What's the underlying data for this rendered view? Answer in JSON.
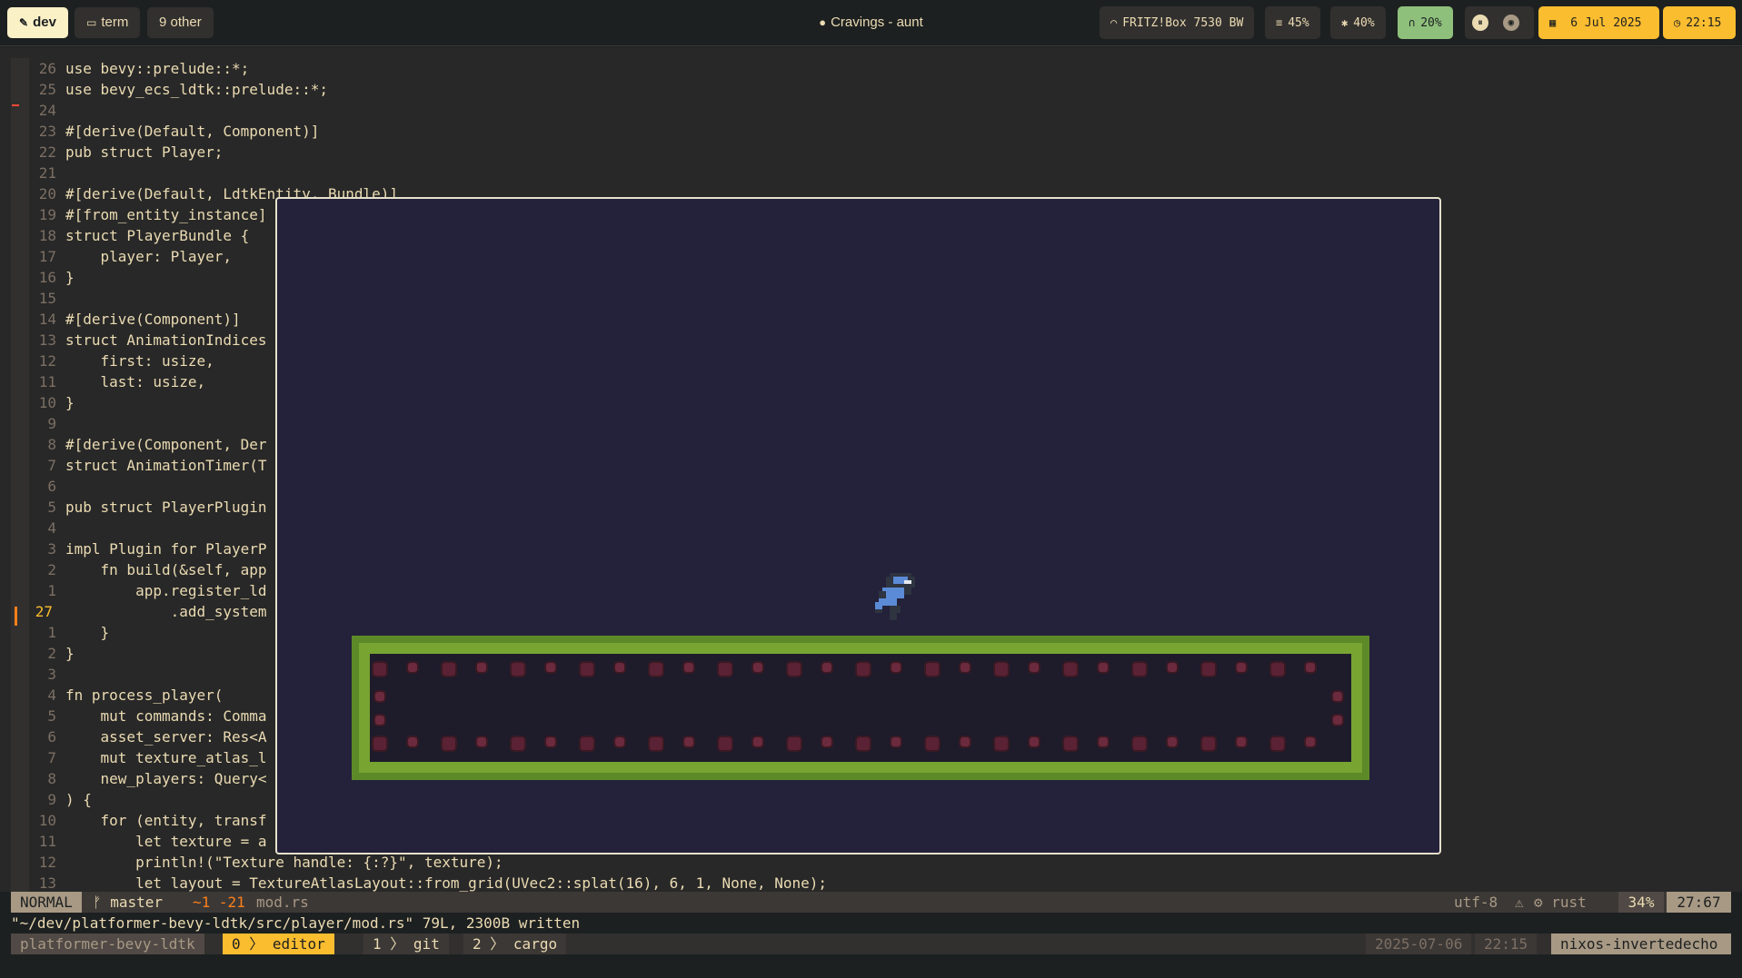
{
  "topbar": {
    "workspaces": [
      {
        "label": "dev",
        "icon": "code-icon"
      },
      {
        "label": "term",
        "icon": "terminal-icon"
      },
      {
        "label": "9 other",
        "icon": ""
      }
    ],
    "window_title": "Cravings - aunt",
    "wifi": "FRITZ!Box 7530 BW",
    "disk": "45%",
    "cpu": "40%",
    "headphones": "20%",
    "date": "6 Jul 2025",
    "time": "22:15",
    "colors": {
      "active": "#fbf1c7",
      "green": "#8ec07c",
      "yellow": "#fabd2f"
    }
  },
  "editor": {
    "lines": [
      {
        "n": "26",
        "text": "use bevy::prelude::*;"
      },
      {
        "n": "25",
        "text": "use bevy_ecs_ldtk::prelude::*;"
      },
      {
        "n": "24",
        "text": ""
      },
      {
        "n": "23",
        "text": "#[derive(Default, Component)]"
      },
      {
        "n": "22",
        "text": "pub struct Player;"
      },
      {
        "n": "21",
        "text": ""
      },
      {
        "n": "20",
        "text": "#[derive(Default, LdtkEntity, Bundle)]"
      },
      {
        "n": "19",
        "text": "#[from_entity_instance]"
      },
      {
        "n": "18",
        "text": "struct PlayerBundle {"
      },
      {
        "n": "17",
        "text": "    player: Player,"
      },
      {
        "n": "16",
        "text": "}"
      },
      {
        "n": "15",
        "text": ""
      },
      {
        "n": "14",
        "text": "#[derive(Component)]"
      },
      {
        "n": "13",
        "text": "struct AnimationIndices"
      },
      {
        "n": "12",
        "text": "    first: usize,"
      },
      {
        "n": "11",
        "text": "    last: usize,"
      },
      {
        "n": "10",
        "text": "}"
      },
      {
        "n": "9",
        "text": ""
      },
      {
        "n": "8",
        "text": "#[derive(Component, Der"
      },
      {
        "n": "7",
        "text": "struct AnimationTimer(T"
      },
      {
        "n": "6",
        "text": ""
      },
      {
        "n": "5",
        "text": "pub struct PlayerPlugin"
      },
      {
        "n": "4",
        "text": ""
      },
      {
        "n": "3",
        "text": "impl Plugin for PlayerP"
      },
      {
        "n": "2",
        "text": "    fn build(&self, app"
      },
      {
        "n": "1",
        "text": "        app.register_ld"
      },
      {
        "n": "27",
        "text": "            .add_system"
      },
      {
        "n": "1",
        "text": "    }"
      },
      {
        "n": "2",
        "text": "}"
      },
      {
        "n": "3",
        "text": ""
      },
      {
        "n": "4",
        "text": "fn process_player("
      },
      {
        "n": "5",
        "text": "    mut commands: Comma"
      },
      {
        "n": "6",
        "text": "    asset_server: Res<A"
      },
      {
        "n": "7",
        "text": "    mut texture_atlas_l"
      },
      {
        "n": "8",
        "text": "    new_players: Query<"
      },
      {
        "n": "9",
        "text": ") {"
      },
      {
        "n": "10",
        "text": "    for (entity, transf"
      },
      {
        "n": "11",
        "text": "        let texture = a"
      },
      {
        "n": "12",
        "text": "        println!(\"Texture handle: {:?}\", texture);"
      },
      {
        "n": "13",
        "text": "        let layout = TextureAtlasLayout::from_grid(UVec2::splat(16), 6, 1, None, None);"
      }
    ]
  },
  "status": {
    "mode": "NORMAL",
    "branch": "master",
    "diff": "~1 -21",
    "file": "mod.rs",
    "encoding": "utf-8",
    "filetype": "rust",
    "percent": "34%",
    "position": "27:67"
  },
  "message": "\"~/dev/platformer-bevy-ldtk/src/player/mod.rs\" 79L, 2300B written",
  "tmux": {
    "session": "platformer-bevy-ldtk",
    "windows": [
      {
        "index": "0",
        "name": "editor"
      },
      {
        "index": "1",
        "name": "git"
      },
      {
        "index": "2",
        "name": "cargo"
      }
    ],
    "date": "2025-07-06",
    "time": "22:15",
    "host": "nixos-invertedecho"
  }
}
